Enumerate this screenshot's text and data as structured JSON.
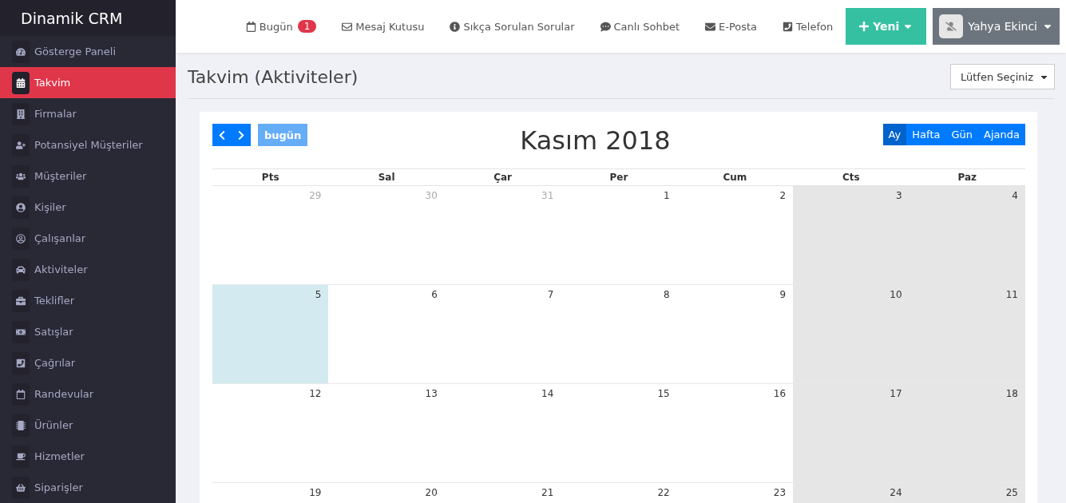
{
  "brand": "Dinamik CRM",
  "sidebar": {
    "items": [
      {
        "label": "Gösterge Paneli",
        "selected": false
      },
      {
        "label": "Takvim",
        "selected": true
      },
      {
        "label": "Firmalar",
        "selected": false
      },
      {
        "label": "Potansiyel Müşteriler",
        "selected": false
      },
      {
        "label": "Müşteriler",
        "selected": false
      },
      {
        "label": "Kişiler",
        "selected": false
      },
      {
        "label": "Çalışanlar",
        "selected": false
      },
      {
        "label": "Aktiviteler",
        "selected": false
      },
      {
        "label": "Teklifler",
        "selected": false
      },
      {
        "label": "Satışlar",
        "selected": false
      },
      {
        "label": "Çağrılar",
        "selected": false
      },
      {
        "label": "Randevular",
        "selected": false
      },
      {
        "label": "Ürünler",
        "selected": false
      },
      {
        "label": "Hizmetler",
        "selected": false
      },
      {
        "label": "Siparişler",
        "selected": false
      }
    ]
  },
  "topbar": {
    "links": [
      {
        "label": "Bugün",
        "badge": "1"
      },
      {
        "label": "Mesaj Kutusu"
      },
      {
        "label": "Sıkça Sorulan Sorular"
      },
      {
        "label": "Canlı Sohbet"
      },
      {
        "label": "E-Posta"
      },
      {
        "label": "Telefon"
      }
    ],
    "new_button": "Yeni",
    "user": "Yahya Ekinci"
  },
  "page": {
    "title": "Takvim (Aktiviteler)",
    "select": "Lütfen Seçiniz"
  },
  "calendar": {
    "title": "Kasım 2018",
    "today_button": "bugün",
    "views": [
      {
        "label": "Ay",
        "selected": true
      },
      {
        "label": "Hafta",
        "selected": false
      },
      {
        "label": "Gün",
        "selected": false
      },
      {
        "label": "Ajanda",
        "selected": false
      }
    ],
    "weekdays": [
      "Pts",
      "Sal",
      "Çar",
      "Per",
      "Cum",
      "Cts",
      "Paz"
    ],
    "weeks": [
      [
        {
          "day": "29",
          "other_month": true,
          "today": false,
          "weekend": false
        },
        {
          "day": "30",
          "other_month": true,
          "today": false,
          "weekend": false
        },
        {
          "day": "31",
          "other_month": true,
          "today": false,
          "weekend": false
        },
        {
          "day": "1",
          "other_month": false,
          "today": false,
          "weekend": false
        },
        {
          "day": "2",
          "other_month": false,
          "today": false,
          "weekend": false
        },
        {
          "day": "3",
          "other_month": false,
          "today": false,
          "weekend": true
        },
        {
          "day": "4",
          "other_month": false,
          "today": false,
          "weekend": true
        }
      ],
      [
        {
          "day": "5",
          "other_month": false,
          "today": true,
          "weekend": false
        },
        {
          "day": "6",
          "other_month": false,
          "today": false,
          "weekend": false
        },
        {
          "day": "7",
          "other_month": false,
          "today": false,
          "weekend": false
        },
        {
          "day": "8",
          "other_month": false,
          "today": false,
          "weekend": false
        },
        {
          "day": "9",
          "other_month": false,
          "today": false,
          "weekend": false
        },
        {
          "day": "10",
          "other_month": false,
          "today": false,
          "weekend": true
        },
        {
          "day": "11",
          "other_month": false,
          "today": false,
          "weekend": true
        }
      ],
      [
        {
          "day": "12",
          "other_month": false,
          "today": false,
          "weekend": false
        },
        {
          "day": "13",
          "other_month": false,
          "today": false,
          "weekend": false
        },
        {
          "day": "14",
          "other_month": false,
          "today": false,
          "weekend": false
        },
        {
          "day": "15",
          "other_month": false,
          "today": false,
          "weekend": false
        },
        {
          "day": "16",
          "other_month": false,
          "today": false,
          "weekend": false
        },
        {
          "day": "17",
          "other_month": false,
          "today": false,
          "weekend": true
        },
        {
          "day": "18",
          "other_month": false,
          "today": false,
          "weekend": true
        }
      ],
      [
        {
          "day": "19",
          "other_month": false,
          "today": false,
          "weekend": false
        },
        {
          "day": "20",
          "other_month": false,
          "today": false,
          "weekend": false
        },
        {
          "day": "21",
          "other_month": false,
          "today": false,
          "weekend": false
        },
        {
          "day": "22",
          "other_month": false,
          "today": false,
          "weekend": false
        },
        {
          "day": "23",
          "other_month": false,
          "today": false,
          "weekend": false
        },
        {
          "day": "24",
          "other_month": false,
          "today": false,
          "weekend": true
        },
        {
          "day": "25",
          "other_month": false,
          "today": false,
          "weekend": true
        }
      ]
    ]
  }
}
